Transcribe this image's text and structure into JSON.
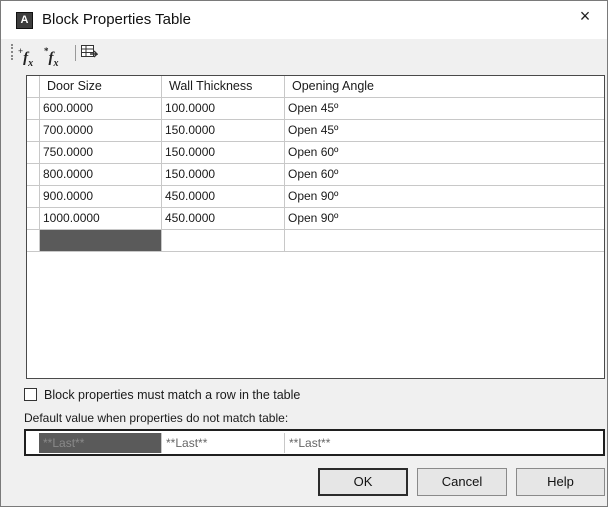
{
  "window": {
    "title": "Block Properties Table",
    "close_glyph": "×"
  },
  "toolbar": {
    "buttons": [
      {
        "name": "add-properties-button",
        "glyph": "f",
        "sup": "+",
        "sub": "x"
      },
      {
        "name": "new-properties-button",
        "glyph": "f",
        "sup": "*",
        "sub": "x"
      },
      {
        "name": "manage-properties-button",
        "icon": "table-import-icon"
      }
    ]
  },
  "table": {
    "columns": [
      "Door Size",
      "Wall Thickness",
      "Opening Angle"
    ],
    "rows": [
      [
        "600.0000",
        "100.0000",
        "Open 45º"
      ],
      [
        "700.0000",
        "150.0000",
        "Open 45º"
      ],
      [
        "750.0000",
        "150.0000",
        "Open 60º"
      ],
      [
        "800.0000",
        "150.0000",
        "Open 60º"
      ],
      [
        "900.0000",
        "450.0000",
        "Open 90º"
      ],
      [
        "1000.0000",
        "450.0000",
        "Open 90º"
      ]
    ]
  },
  "match_row_checkbox": {
    "label": "Block properties must match a row in the table",
    "checked": false
  },
  "defaults": {
    "label": "Default value when properties do not match table:",
    "values": [
      "**Last**",
      "**Last**",
      "**Last**"
    ]
  },
  "buttons": {
    "ok": "OK",
    "cancel": "Cancel",
    "help": "Help"
  },
  "colors": {
    "selected_cell": "#5a5a5a",
    "dialog_bg": "#f0f0f0"
  }
}
